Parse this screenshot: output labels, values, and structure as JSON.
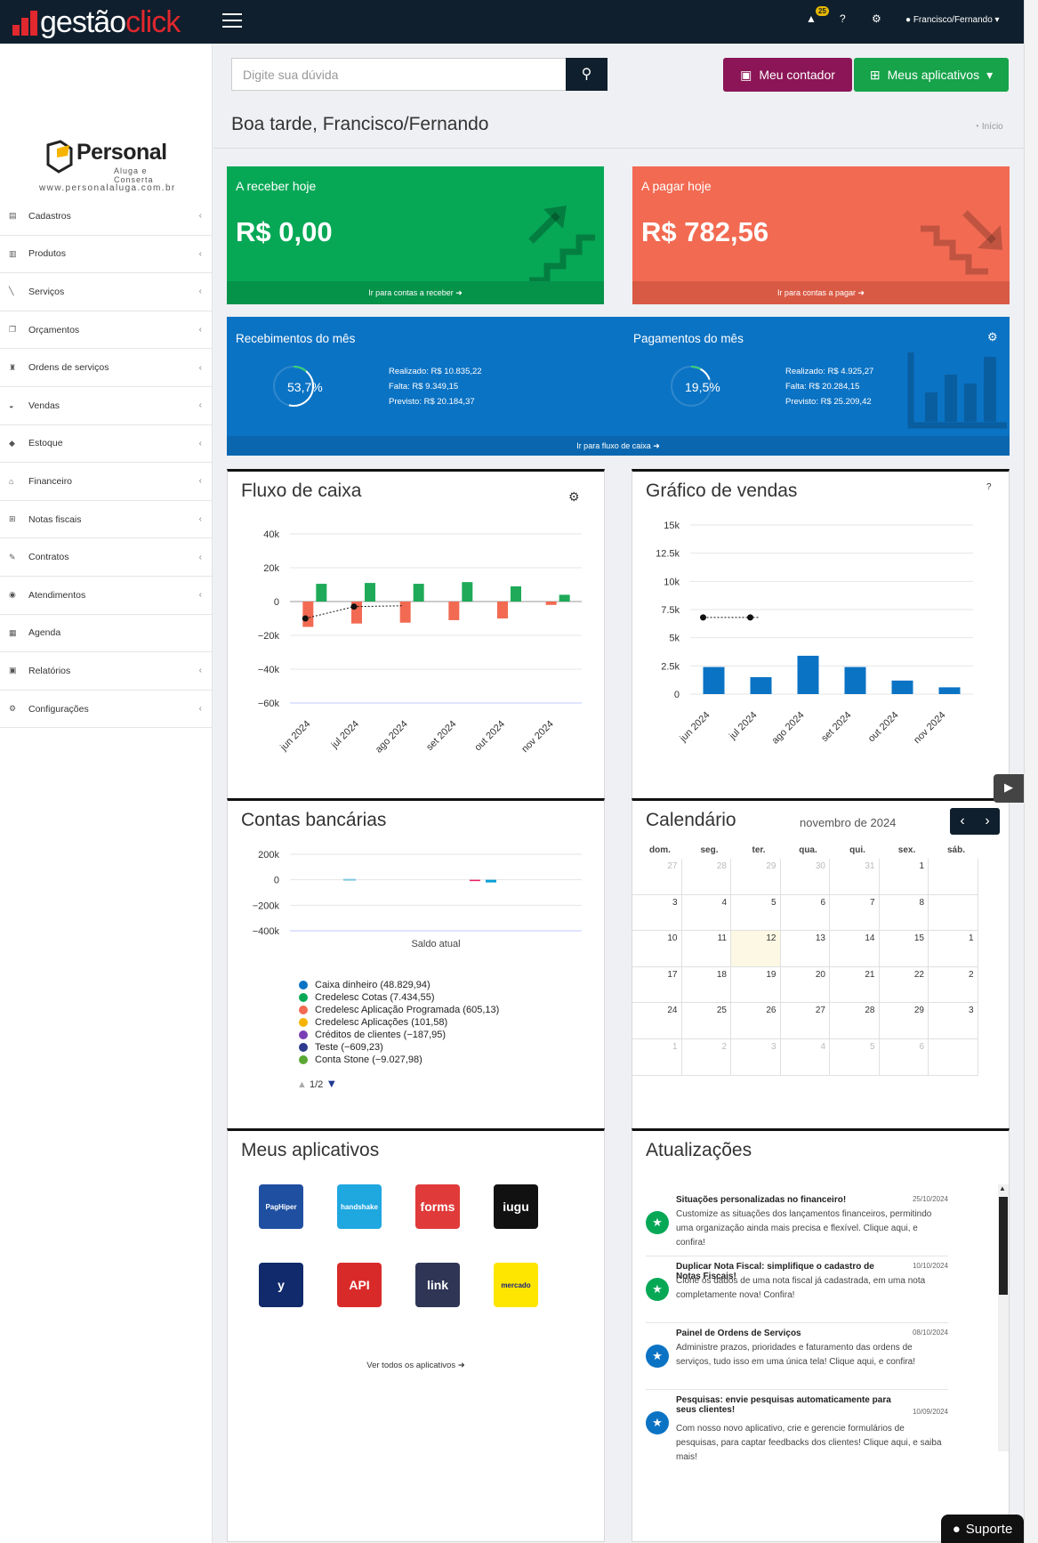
{
  "app": {
    "name_part1": "gestão",
    "name_part2": "click",
    "notif_count": "25",
    "user": "Francisco/Fernando"
  },
  "company": {
    "name": "Personal",
    "tagline": "Aluga e Conserta",
    "website": "www.personalaluga.com.br"
  },
  "sidebar": {
    "items": [
      {
        "label": "Cadastros",
        "icon": "id-card-icon"
      },
      {
        "label": "Produtos",
        "icon": "barcode-icon"
      },
      {
        "label": "Serviços",
        "icon": "wrench-icon"
      },
      {
        "label": "Orçamentos",
        "icon": "copy-icon"
      },
      {
        "label": "Ordens de serviços",
        "icon": "trophy-icon"
      },
      {
        "label": "Vendas",
        "icon": "basket-icon"
      },
      {
        "label": "Estoque",
        "icon": "cube-icon"
      },
      {
        "label": "Financeiro",
        "icon": "bank-icon"
      },
      {
        "label": "Notas fiscais",
        "icon": "sitemap-icon"
      },
      {
        "label": "Contratos",
        "icon": "edit-icon"
      },
      {
        "label": "Atendimentos",
        "icon": "comments-icon"
      },
      {
        "label": "Agenda",
        "icon": "calendar-icon"
      },
      {
        "label": "Relatórios",
        "icon": "report-icon"
      },
      {
        "label": "Configurações",
        "icon": "cogs-icon"
      }
    ]
  },
  "header": {
    "search_placeholder": "Digite sua dúvida",
    "btn_contador": "Meu contador",
    "btn_apps": "Meus aplicativos",
    "greeting": "Boa tarde, Francisco/Fernando",
    "breadcrumb": "Início"
  },
  "kpis": {
    "receber": {
      "title": "A receber hoje",
      "value": "R$ 0,00",
      "link": "Ir para contas a receber",
      "color": "#06a856"
    },
    "pagar": {
      "title": "A pagar hoje",
      "value": "R$ 782,56",
      "link": "Ir para contas a pagar",
      "color": "#f26a52"
    }
  },
  "monthly": {
    "receb": {
      "title": "Recebimentos do mês",
      "pct": "53,7%",
      "realizado": "Realizado: R$ 10.835,22",
      "falta": "Falta: R$ 9.349,15",
      "previsto": "Previsto: R$ 20.184,37",
      "pct_value": 53.7
    },
    "pag": {
      "title": "Pagamentos do mês",
      "pct": "19,5%",
      "realizado": "Realizado: R$ 4.925,27",
      "falta": "Falta: R$ 20.284,15",
      "previsto": "Previsto: R$ 25.209,42",
      "pct_value": 19.5
    },
    "link": "Ir para fluxo de caixa"
  },
  "fluxo": {
    "title": "Fluxo de caixa"
  },
  "vendas": {
    "title": "Gráfico de vendas"
  },
  "contas": {
    "title": "Contas bancárias",
    "xlabel": "Saldo atual",
    "legend": [
      {
        "name": "Caixa dinheiro (48.829,94)",
        "color": "#0b73c4"
      },
      {
        "name": "Credelesc Cotas (7.434,55)",
        "color": "#06a856"
      },
      {
        "name": "Credelesc Aplicação Programada (605,13)",
        "color": "#f26a52"
      },
      {
        "name": "Credelesc Aplicações (101,58)",
        "color": "#f6b400"
      },
      {
        "name": "Créditos de clientes (−187,95)",
        "color": "#7b3fb5"
      },
      {
        "name": "Teste (−609,23)",
        "color": "#2e3a8c"
      },
      {
        "name": "Conta Stone (−9.027,98)",
        "color": "#5aa832"
      }
    ],
    "pager": "1/2"
  },
  "calendar": {
    "title": "Calendário",
    "month": "novembro de 2024",
    "weekdays": [
      "dom.",
      "seg.",
      "ter.",
      "qua.",
      "qui.",
      "sex.",
      "sáb."
    ],
    "days": [
      "27",
      "28",
      "29",
      "30",
      "31",
      "1",
      "",
      "3",
      "4",
      "5",
      "6",
      "7",
      "8",
      "",
      "10",
      "11",
      "12",
      "13",
      "14",
      "15",
      "1",
      "17",
      "18",
      "19",
      "20",
      "21",
      "22",
      "2",
      "24",
      "25",
      "26",
      "27",
      "28",
      "29",
      "3",
      "1",
      "2",
      "3",
      "4",
      "5",
      "6",
      ""
    ]
  },
  "apps": {
    "title": "Meus aplicativos",
    "items": [
      {
        "label": "PagHiper",
        "color": "#1f4fa0"
      },
      {
        "label": "handshake",
        "color": "#1fa7e0"
      },
      {
        "label": "forms",
        "color": "#e03a3a"
      },
      {
        "label": "iugu",
        "color": "#111111"
      },
      {
        "label": "y",
        "color": "#102a6b"
      },
      {
        "label": "API",
        "color": "#d92a2a"
      },
      {
        "label": "link",
        "color": "#2f3554"
      },
      {
        "label": "mercado",
        "color": "#ffe600"
      }
    ],
    "link": "Ver todos os aplicativos"
  },
  "updates": {
    "title": "Atualizações",
    "items": [
      {
        "title": "Situações personalizadas no financeiro!",
        "date": "25/10/2024",
        "text": "Customize as situações dos lançamentos financeiros, permitindo uma organização ainda mais precisa e flexível. Clique aqui, e confira!",
        "color": "#06a856"
      },
      {
        "title": "Duplicar Nota Fiscal: simplifique o cadastro de Notas Fiscais!",
        "date": "10/10/2024",
        "text": "Clone os dados de uma nota fiscal já cadastrada, em uma nota completamente nova! Confira!",
        "color": "#06a856"
      },
      {
        "title": "Painel de Ordens de Serviços",
        "date": "08/10/2024",
        "text": "Administre prazos, prioridades e faturamento das ordens de serviços, tudo isso em uma única tela! Clique aqui, e confira!",
        "color": "#0b73c4"
      },
      {
        "title": "Pesquisas: envie pesquisas automaticamente para seus clientes!",
        "date": "10/09/2024",
        "text": "Com nosso novo aplicativo, crie e gerencie formulários de pesquisas, para captar feedbacks dos clientes! Clique aqui, e saiba mais!",
        "color": "#0b73c4"
      }
    ]
  },
  "suporte": "Suporte",
  "chart_data": [
    {
      "type": "bar",
      "title": "Fluxo de caixa",
      "categories": [
        "jun 2024",
        "jul 2024",
        "ago 2024",
        "set 2024",
        "out 2024",
        "nov 2024"
      ],
      "ylim": [
        -60000,
        40000
      ],
      "yticks": [
        "40k",
        "20k",
        "0",
        "−20k",
        "−40k",
        "−60k"
      ],
      "series": [
        {
          "values": [
            10500,
            11000,
            10500,
            11500,
            9000,
            4000
          ],
          "color": "#1faa59"
        },
        {
          "values": [
            -15000,
            -13000,
            -12500,
            -11000,
            -10000,
            -2000
          ],
          "color": "#f26a52"
        },
        {
          "values": [
            -10000,
            -3000,
            -2500
          ],
          "color": "#111111"
        }
      ]
    },
    {
      "type": "bar",
      "title": "Gráfico de vendas",
      "categories": [
        "jun 2024",
        "jul 2024",
        "ago 2024",
        "set 2024",
        "out 2024",
        "nov 2024"
      ],
      "ylim": [
        0,
        15000
      ],
      "yticks": [
        "15k",
        "12.5k",
        "10k",
        "7.5k",
        "5k",
        "2.5k",
        "0"
      ],
      "series": [
        {
          "values": [
            2400,
            1500,
            3400,
            2400,
            1200,
            600
          ],
          "color": "#0b73c4"
        },
        {
          "values": [
            6800,
            6800
          ],
          "color": "#111111"
        }
      ]
    },
    {
      "type": "bar",
      "title": "Contas bancárias",
      "categories": [
        "Saldo atual"
      ],
      "ylim": [
        -400000,
        200000
      ],
      "yticks": [
        "200k",
        "0",
        "−200k",
        "−400k"
      ]
    }
  ]
}
